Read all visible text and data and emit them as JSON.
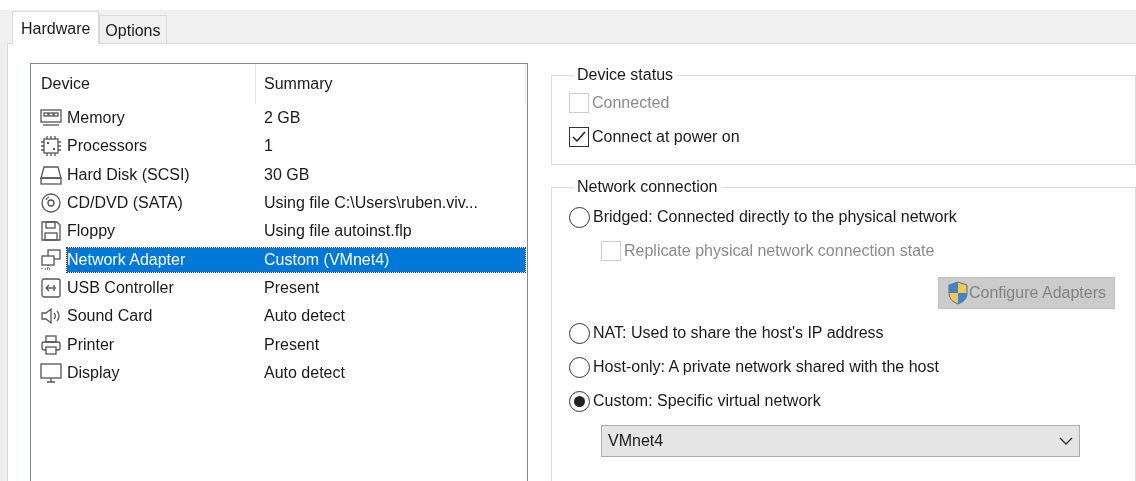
{
  "tabs": [
    {
      "label": "Hardware",
      "selected": true
    },
    {
      "label": "Options",
      "selected": false
    }
  ],
  "device_list": {
    "columns": [
      "Device",
      "Summary"
    ],
    "rows": [
      {
        "device": "Memory",
        "summary": "2 GB",
        "selected": false
      },
      {
        "device": "Processors",
        "summary": "1",
        "selected": false
      },
      {
        "device": "Hard Disk (SCSI)",
        "summary": "30 GB",
        "selected": false
      },
      {
        "device": "CD/DVD (SATA)",
        "summary": "Using file C:\\Users\\ruben.viv...",
        "selected": false
      },
      {
        "device": "Floppy",
        "summary": "Using file autoinst.flp",
        "selected": false
      },
      {
        "device": "Network Adapter",
        "summary": "Custom (VMnet4)",
        "selected": true
      },
      {
        "device": "USB Controller",
        "summary": "Present",
        "selected": false
      },
      {
        "device": "Sound Card",
        "summary": "Auto detect",
        "selected": false
      },
      {
        "device": "Printer",
        "summary": "Present",
        "selected": false
      },
      {
        "device": "Display",
        "summary": "Auto detect",
        "selected": false
      }
    ]
  },
  "device_status": {
    "title": "Device status",
    "checkboxes": [
      {
        "label": "Connected",
        "checked": false,
        "disabled": true
      },
      {
        "label": "Connect at power on",
        "checked": true,
        "disabled": false
      }
    ]
  },
  "network_connection": {
    "title": "Network connection",
    "options": [
      {
        "label": "Bridged: Connected directly to the physical network",
        "selected": false
      },
      {
        "label": "NAT: Used to share the host's IP address",
        "selected": false
      },
      {
        "label": "Host-only: A private network shared with the host",
        "selected": false
      },
      {
        "label": "Custom: Specific virtual network",
        "selected": true
      }
    ],
    "replicate": {
      "label": "Replicate physical network connection state",
      "checked": false,
      "disabled": true
    },
    "configure_button": {
      "label": "Configure Adapters",
      "disabled": true
    },
    "network_select": {
      "value": "VMnet4"
    }
  }
}
